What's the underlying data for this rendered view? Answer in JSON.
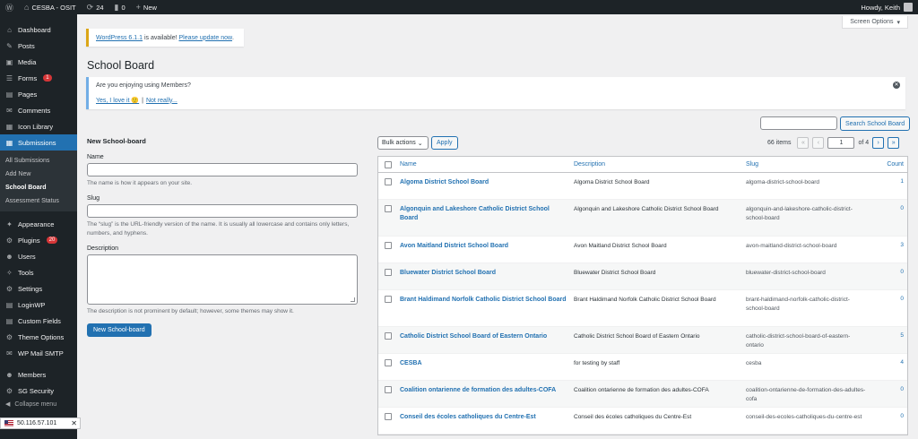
{
  "adminbar": {
    "site_name": "CESBA - OSIT",
    "updates_count": "24",
    "comments_count": "0",
    "new_label": "New",
    "howdy": "Howdy, Keith"
  },
  "sidebar": {
    "items_top": [
      {
        "label": "Dashboard",
        "icon": "⌂"
      },
      {
        "label": "Posts",
        "icon": "✎"
      },
      {
        "label": "Media",
        "icon": "▣"
      },
      {
        "label": "Forms",
        "icon": "☰",
        "badge": "1"
      },
      {
        "label": "Pages",
        "icon": "▤"
      },
      {
        "label": "Comments",
        "icon": "✉"
      },
      {
        "label": "Icon Library",
        "icon": "▦"
      },
      {
        "label": "Submissions",
        "icon": "▦",
        "current": true
      }
    ],
    "submenu": [
      {
        "label": "All Submissions"
      },
      {
        "label": "Add New"
      },
      {
        "label": "School Board",
        "current": true
      },
      {
        "label": "Assessment Status"
      }
    ],
    "items_bottom": [
      {
        "label": "Appearance",
        "icon": "✦"
      },
      {
        "label": "Plugins",
        "icon": "⚙",
        "badge": "20"
      },
      {
        "label": "Users",
        "icon": "☻"
      },
      {
        "label": "Tools",
        "icon": "✧"
      },
      {
        "label": "Settings",
        "icon": "⚙"
      },
      {
        "label": "LoginWP",
        "icon": "▤"
      },
      {
        "label": "Custom Fields",
        "icon": "▤"
      },
      {
        "label": "Theme Options",
        "icon": "⚙"
      },
      {
        "label": "WP Mail SMTP",
        "icon": "✉"
      }
    ],
    "items_extra": [
      {
        "label": "Members",
        "icon": "☻"
      },
      {
        "label": "SG Security",
        "icon": "⚙"
      }
    ],
    "collapse_label": "Collapse menu",
    "ip": "50.116.57.101"
  },
  "screen_options": "Screen Options",
  "update_notice": {
    "link1": "WordPress 6.1.1",
    "middle": " is available! ",
    "link2": "Please update now",
    "end": "."
  },
  "page_title": "School Board",
  "members_notice": {
    "question": "Are you enjoying using Members?",
    "yes": "Yes, I love it 🙂",
    "sep": "|",
    "no": "Not really..."
  },
  "form": {
    "title": "New School-board",
    "name_label": "Name",
    "name_help": "The name is how it appears on your site.",
    "slug_label": "Slug",
    "slug_help": "The “slug” is the URL-friendly version of the name. It is usually all lowercase and contains only letters, numbers, and hyphens.",
    "desc_label": "Description",
    "desc_help": "The description is not prominent by default; however, some themes may show it.",
    "submit": "New School-board"
  },
  "search": {
    "button": "Search School Board"
  },
  "tablenav": {
    "bulk": "Bulk actions",
    "apply": "Apply",
    "items": "66 items",
    "first": "«",
    "prev": "‹",
    "page": "1",
    "of": "of 4",
    "next": "›",
    "last": "»"
  },
  "table": {
    "headers": {
      "name": "Name",
      "description": "Description",
      "slug": "Slug",
      "count": "Count"
    },
    "rows": [
      {
        "name": "Algoma District School Board",
        "description": "Algoma District School Board",
        "slug": "algoma-district-school-board",
        "count": "1"
      },
      {
        "name": "Algonquin and Lakeshore Catholic District School Board",
        "description": "Algonquin and Lakeshore Catholic District School Board",
        "slug": "algonquin-and-lakeshore-catholic-district-school-board",
        "count": "0"
      },
      {
        "name": "Avon Maitland District School Board",
        "description": "Avon Maitland District School Board",
        "slug": "avon-maitland-district-school-board",
        "count": "3"
      },
      {
        "name": "Bluewater District School Board",
        "description": "Bluewater District School Board",
        "slug": "bluewater-district-school-board",
        "count": "0"
      },
      {
        "name": "Brant Haldimand Norfolk Catholic District School Board",
        "description": "Brant Haldimand Norfolk Catholic District School Board",
        "slug": "brant-haldimand-norfolk-catholic-district-school-board",
        "count": "0"
      },
      {
        "name": "Catholic District School Board of Eastern Ontario",
        "description": "Catholic District School Board of Eastern Ontario",
        "slug": "catholic-district-school-board-of-eastern-ontario",
        "count": "5"
      },
      {
        "name": "CESBA",
        "description": "for testing by staff",
        "slug": "cesba",
        "count": "4"
      },
      {
        "name": "Coalition ontarienne de formation des adultes-COFA",
        "description": "Coalition ontarienne de formation des adultes-COFA",
        "slug": "coalition-ontarienne-de-formation-des-adultes-cofa",
        "count": "0"
      },
      {
        "name": "Conseil des écoles catholiques du Centre-Est",
        "description": "Conseil des écoles catholiques du Centre-Est",
        "slug": "conseil-des-ecoles-catholiques-du-centre-est",
        "count": "0"
      }
    ]
  }
}
